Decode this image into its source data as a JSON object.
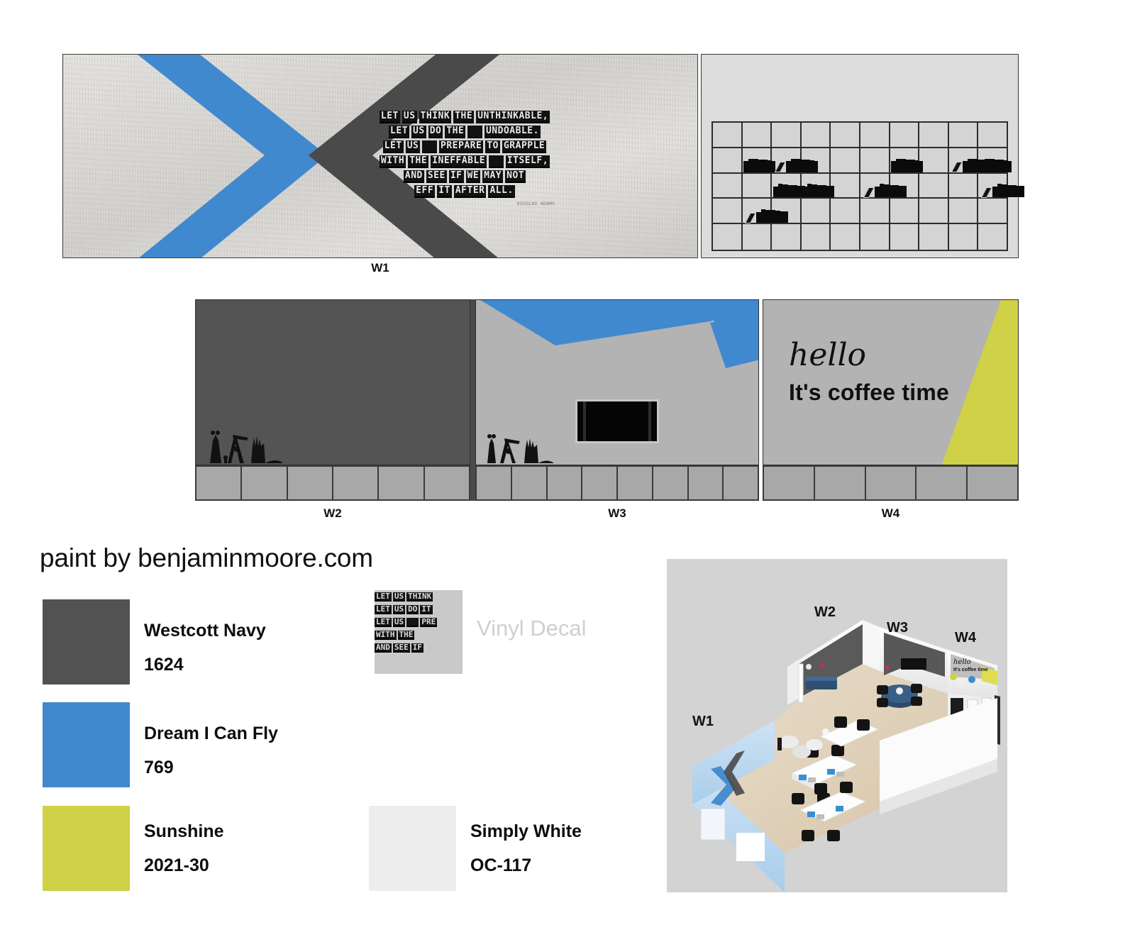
{
  "elevations": {
    "w1": {
      "label": "W1",
      "quote_lines": [
        [
          "LET",
          "US",
          "THINK",
          "THE",
          "UNTHINKABLE,"
        ],
        [
          "LET",
          "US",
          "DO",
          "THE",
          " ",
          "UNDOABLE."
        ],
        [
          "LET",
          "US",
          " ",
          "PREPARE",
          "TO",
          "GRAPPLE"
        ],
        [
          "WITH",
          "THE",
          "INEFFABLE",
          " ",
          "ITSELF,"
        ],
        [
          "AND",
          "SEE",
          "IF",
          "WE",
          "MAY",
          "NOT"
        ],
        [
          "EFF",
          "IT",
          "AFTER",
          "ALL."
        ]
      ],
      "attribution": "DOUGLAS ADAMS",
      "bookshelf_rows": 5,
      "bookshelf_cols": 10
    },
    "w2": {
      "label": "W2",
      "wall_color": "#545454",
      "cabinets": 6
    },
    "w3": {
      "label": "W3",
      "wall_color": "#b3b3b3",
      "accent_color": "#4089cf",
      "cabinets": 8,
      "has_tv": true
    },
    "w4": {
      "label": "W4",
      "wall_color": "#b3b3b3",
      "accent_color": "#cfd146",
      "cabinets": 5,
      "hello_text": "hello",
      "coffee_text": "It's coffee time"
    }
  },
  "paint": {
    "title": "paint by benjaminmoore.com",
    "swatches": [
      {
        "name": "Westcott Navy",
        "code": "1624",
        "hex": "#525252"
      },
      {
        "name": "Dream I Can Fly",
        "code": "769",
        "hex": "#4089cf"
      },
      {
        "name": "Sunshine",
        "code": "2021-30",
        "hex": "#cfd146"
      },
      {
        "name": "Simply White",
        "code": "OC-117",
        "hex": "#ededed"
      }
    ]
  },
  "decal": {
    "label": "Vinyl Decal",
    "preview_lines": [
      [
        "LET",
        "US",
        "THINK"
      ],
      [
        "LET",
        "US",
        "DO",
        "IT"
      ],
      [
        "LET",
        "US",
        " ",
        "PRE"
      ],
      [
        "WITH",
        "THE"
      ],
      [
        "AND",
        "SEE",
        "IF"
      ]
    ]
  },
  "floorplan": {
    "labels": [
      "W1",
      "W2",
      "W3",
      "W4"
    ],
    "hello_text": "hello",
    "coffee_text": "It's coffee time"
  }
}
